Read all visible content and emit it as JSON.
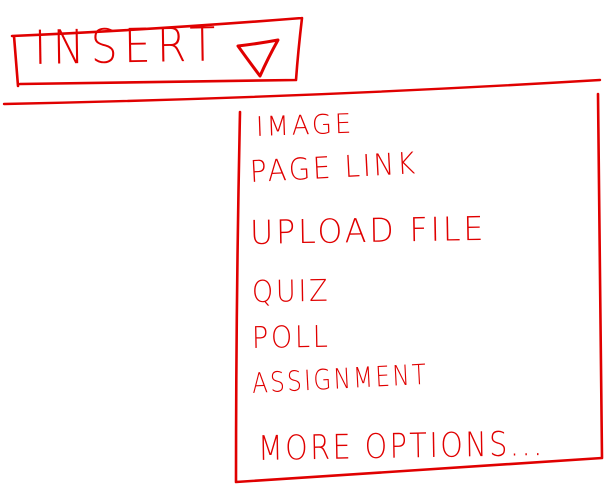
{
  "insert_button": {
    "label": "INSERT",
    "icon": "triangle-down-icon"
  },
  "menu": {
    "items": [
      {
        "label": "IMAGE"
      },
      {
        "label": "PAGE LINK"
      },
      {
        "label": "UPLOAD FILE"
      },
      {
        "label": "QUIZ"
      },
      {
        "label": "POLL"
      },
      {
        "label": "ASSIGNMENT"
      },
      {
        "label": "MORE OPTIONS..."
      }
    ]
  },
  "colors": {
    "ink": "#e00000",
    "background": "#ffffff"
  }
}
